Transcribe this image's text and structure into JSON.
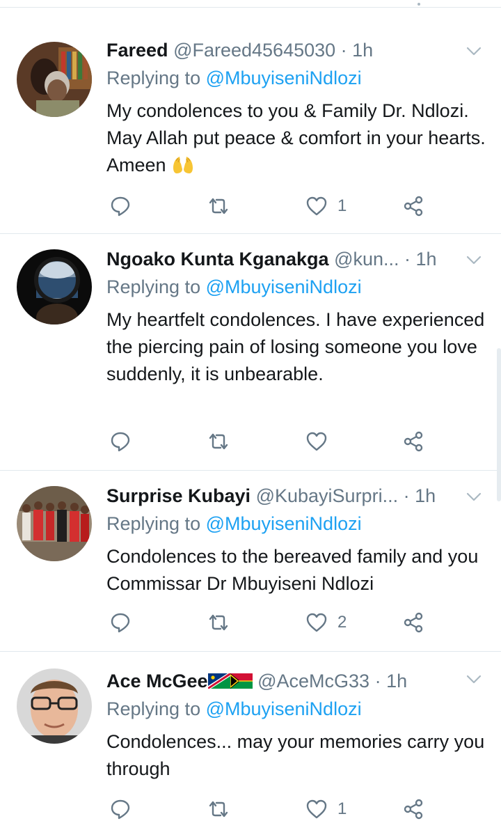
{
  "tweets": [
    {
      "name": "Fareed",
      "handle": "@Fareed45645030",
      "sep": " · ",
      "time": "1h",
      "replying_prefix": "Replying to ",
      "replying_mention": "@MbuyiseniNdlozi",
      "text": "My condolences to you &  Family Dr. Ndlozi. May Allah put peace & comfort in your hearts. Ameen",
      "emoji": "open-hands-emoji",
      "likes": "1"
    },
    {
      "name": "Ngoako Kunta Kganakga",
      "handle": "@kun...",
      "sep": " · ",
      "time": "1h",
      "replying_prefix": "Replying to ",
      "replying_mention": "@MbuyiseniNdlozi",
      "text": "My heartfelt condolences. I have experienced the piercing pain of losing someone you love suddenly, it is unbearable.",
      "likes": ""
    },
    {
      "name": "Surprise Kubayi",
      "handle": "@KubayiSurpri...",
      "sep": " · ",
      "time": "1h",
      "replying_prefix": "Replying to ",
      "replying_mention": "@MbuyiseniNdlozi",
      "text": "Condolences to the bereaved family and you Commissar Dr Mbuyiseni Ndlozi",
      "likes": "2"
    },
    {
      "name": "Ace McGee",
      "handle": "@AceMcG33",
      "sep": " · ",
      "time": "1h",
      "replying_prefix": "Replying to ",
      "replying_mention": "@MbuyiseniNdlozi",
      "text": "Condolences... may your memories carry you through",
      "flags": [
        "namibia-flag",
        "vanuatu-flag"
      ],
      "likes": "1"
    }
  ],
  "colors": {
    "link": "#1da1f2",
    "secondary": "#657786",
    "icon": "#657786",
    "divider": "#e1e8ed"
  },
  "icons": [
    "reply-icon",
    "retweet-icon",
    "like-icon",
    "share-icon",
    "chevron-down-icon"
  ]
}
